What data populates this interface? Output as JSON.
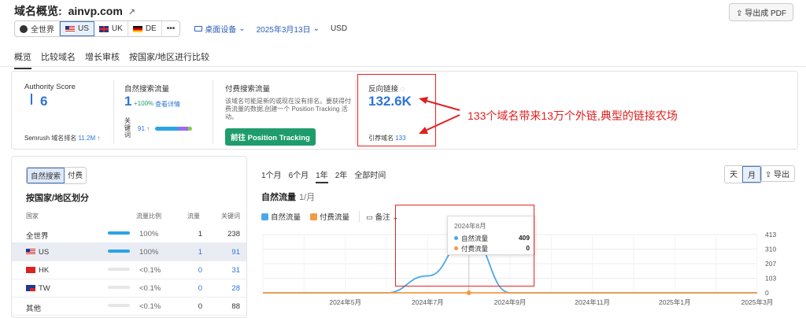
{
  "header": {
    "title": "域名概览:",
    "domain": "ainvp.com",
    "export_pdf": "导出成 PDF"
  },
  "controls": {
    "regions": [
      {
        "label": "全世界",
        "icon": "globe-icon",
        "active": false
      },
      {
        "label": "US",
        "icon": "flag-us-icon",
        "active": true
      },
      {
        "label": "UK",
        "icon": "flag-uk-icon",
        "active": false
      },
      {
        "label": "DE",
        "icon": "flag-de-icon",
        "active": false
      }
    ],
    "more": "•••",
    "device": "桌面设备",
    "date": "2025年3月13日",
    "currency": "USD"
  },
  "tabs": [
    "概览",
    "比较域名",
    "增长审核",
    "按国家/地区进行比较"
  ],
  "summary": {
    "authority": {
      "label": "Authority Score",
      "value": "6",
      "rank_label": "Semrush 域名排名",
      "rank_value": "11.2M ↑"
    },
    "organic": {
      "label": "自然搜索流量",
      "value": "1",
      "change": "+100%",
      "detail_link": "查看详情",
      "kw_label": "关\n键\n词",
      "kw_value": "91 ↑"
    },
    "paid": {
      "label": "付费搜索流量",
      "desc": "该域名可能是新的或现在没有排名。要获得付费流量的数据,创建一个 Position Tracking 活动。",
      "button": "前往 Position Tracking"
    },
    "backlinks": {
      "label": "反向链接",
      "value": "132.6K",
      "ref_label": "引荐域名",
      "ref_value": "133"
    },
    "annotation": "133个域名带来13万个外链,典型的链接农场"
  },
  "left": {
    "toggle": [
      "自然搜索",
      "付费"
    ],
    "title": "按国家/地区划分",
    "columns": [
      "国家",
      "流量比例",
      "流量",
      "关键词"
    ],
    "rows": [
      {
        "country": "全世界",
        "flag": "",
        "share": "100%",
        "share_val": 1.0,
        "traffic": "1",
        "keywords": "238",
        "selected": false,
        "link": false
      },
      {
        "country": "US",
        "flag": "flag-us-icon",
        "share": "100%",
        "share_val": 1.0,
        "traffic": "1",
        "keywords": "91",
        "selected": true,
        "link": true
      },
      {
        "country": "HK",
        "flag": "flag-hk-icon",
        "share": "<0.1%",
        "share_val": 0.0,
        "traffic": "0",
        "keywords": "31",
        "selected": false,
        "link": true
      },
      {
        "country": "TW",
        "flag": "flag-tw-icon",
        "share": "<0.1%",
        "share_val": 0.0,
        "traffic": "0",
        "keywords": "28",
        "selected": false,
        "link": true
      },
      {
        "country": "其他",
        "flag": "",
        "share": "<0.1%",
        "share_val": 0.0,
        "traffic": "0",
        "keywords": "88",
        "selected": false,
        "link": false
      }
    ]
  },
  "right": {
    "periods": [
      "1个月",
      "6个月",
      "1年",
      "2年",
      "全部时间"
    ],
    "active_period": "1年",
    "granularity": [
      "天",
      "月"
    ],
    "export": "导出",
    "chart_title": "自然流量",
    "chart_sub": "1/月",
    "legend": {
      "organic": "自然流量",
      "paid": "付费流量",
      "notes": "备注"
    },
    "tooltip": {
      "date": "2024年8月",
      "organic_label": "自然流量",
      "organic_value": "409",
      "paid_label": "付费流量",
      "paid_value": "0"
    }
  },
  "chart_data": {
    "type": "line",
    "x": [
      "2024年3月",
      "2024年4月",
      "2024年5月",
      "2024年6月",
      "2024年7月",
      "2024年8月",
      "2024年9月",
      "2024年10月",
      "2024年11月",
      "2024年12月",
      "2025年1月",
      "2025年2月",
      "2025年3月"
    ],
    "x_ticks": [
      "2024年5月",
      "2024年7月",
      "2024年9月",
      "2024年11月",
      "2025年1月",
      "2025年3月"
    ],
    "series": [
      {
        "name": "自然流量",
        "color": "#4aa8ea",
        "values": [
          0,
          0,
          0,
          0,
          120,
          409,
          0,
          0,
          0,
          0,
          0,
          0,
          0
        ]
      },
      {
        "name": "付费流量",
        "color": "#f39a45",
        "values": [
          0,
          0,
          0,
          0,
          0,
          0,
          0,
          0,
          0,
          0,
          0,
          0,
          0
        ]
      }
    ],
    "y_ticks": [
      "413",
      "310",
      "207",
      "103",
      "0"
    ],
    "ylim": [
      0,
      413
    ],
    "grid": true
  }
}
